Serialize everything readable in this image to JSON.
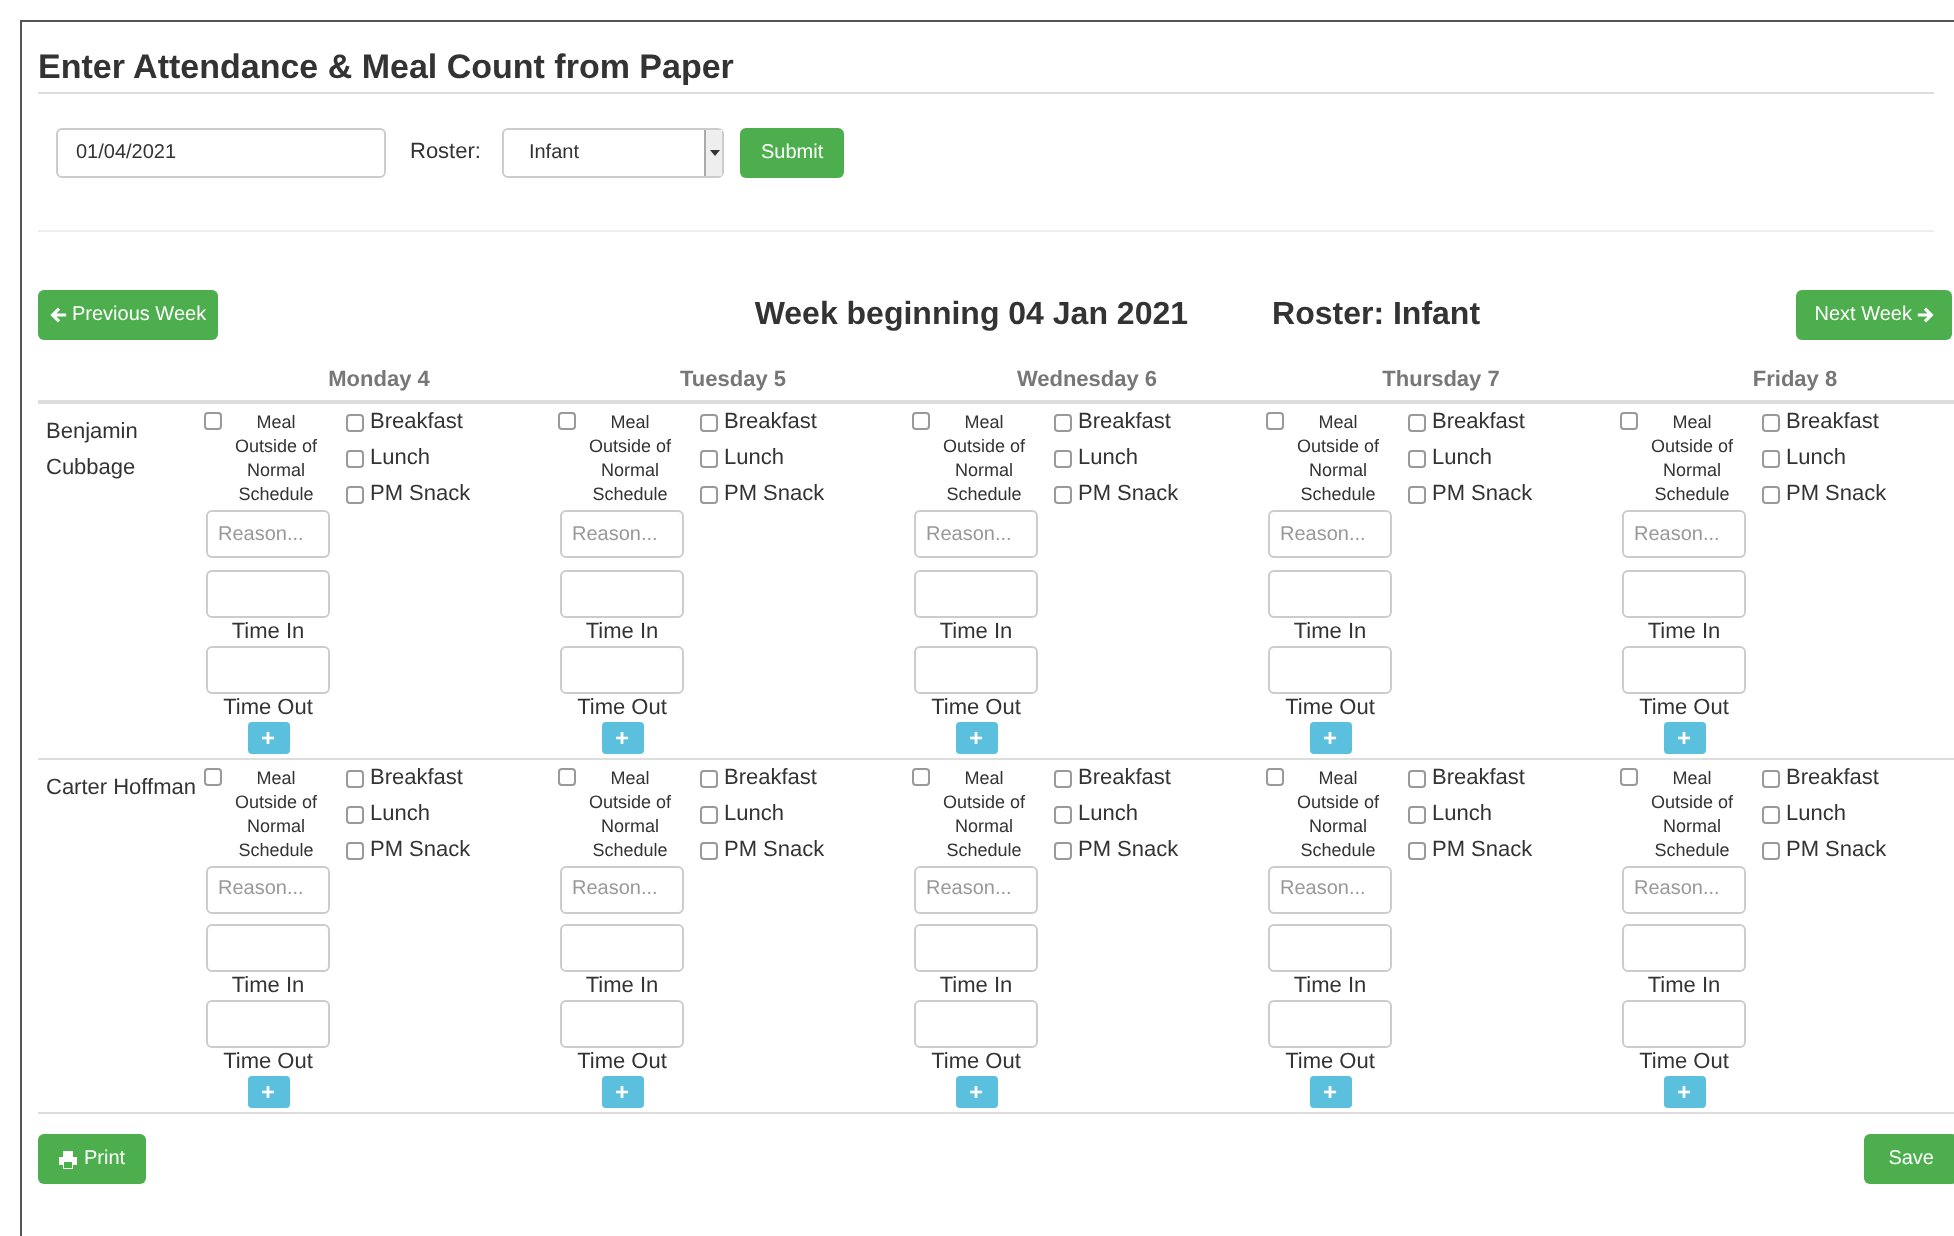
{
  "title": "Enter Attendance & Meal Count from Paper",
  "form": {
    "date": "01/04/2021",
    "roster_label": "Roster:",
    "roster_value": "Infant",
    "submit": "Submit"
  },
  "week_nav": {
    "previous": "Previous Week",
    "heading": "Week beginning 04 Jan 2021",
    "roster_heading": "Roster: Infant",
    "next": "Next Week"
  },
  "days": [
    "Monday 4",
    "Tuesday 5",
    "Wednesday 6",
    "Thursday 7",
    "Friday 8"
  ],
  "children": [
    {
      "name": "Benjamin Cubbage",
      "days": [
        {
          "meal_outside": {
            "label": "Meal Outside of Normal Schedule",
            "checked": false
          },
          "meals": [
            {
              "label": "Breakfast",
              "checked": false
            },
            {
              "label": "Lunch",
              "checked": false
            },
            {
              "label": "PM Snack",
              "checked": false
            }
          ],
          "reason_placeholder": "Reason...",
          "time_in": "Time In",
          "time_out": "Time Out",
          "add": "+"
        },
        {
          "meal_outside": {
            "label": "Meal Outside of Normal Schedule",
            "checked": false
          },
          "meals": [
            {
              "label": "Breakfast",
              "checked": false
            },
            {
              "label": "Lunch",
              "checked": false
            },
            {
              "label": "PM Snack",
              "checked": false
            }
          ],
          "reason_placeholder": "Reason...",
          "time_in": "Time In",
          "time_out": "Time Out",
          "add": "+"
        },
        {
          "meal_outside": {
            "label": "Meal Outside of Normal Schedule",
            "checked": false
          },
          "meals": [
            {
              "label": "Breakfast",
              "checked": false
            },
            {
              "label": "Lunch",
              "checked": false
            },
            {
              "label": "PM Snack",
              "checked": false
            }
          ],
          "reason_placeholder": "Reason...",
          "time_in": "Time In",
          "time_out": "Time Out",
          "add": "+"
        },
        {
          "meal_outside": {
            "label": "Meal Outside of Normal Schedule",
            "checked": false
          },
          "meals": [
            {
              "label": "Breakfast",
              "checked": false
            },
            {
              "label": "Lunch",
              "checked": false
            },
            {
              "label": "PM Snack",
              "checked": false
            }
          ],
          "reason_placeholder": "Reason...",
          "time_in": "Time In",
          "time_out": "Time Out",
          "add": "+"
        },
        {
          "meal_outside": {
            "label": "Meal Outside of Normal Schedule",
            "checked": false
          },
          "meals": [
            {
              "label": "Breakfast",
              "checked": false
            },
            {
              "label": "Lunch",
              "checked": false
            },
            {
              "label": "PM Snack",
              "checked": false
            }
          ],
          "reason_placeholder": "Reason...",
          "time_in": "Time In",
          "time_out": "Time Out",
          "add": "+"
        }
      ]
    },
    {
      "name": "Carter Hoffman",
      "days": [
        {
          "meal_outside": {
            "label": "Meal Outside of Normal Schedule",
            "checked": false
          },
          "meals": [
            {
              "label": "Breakfast",
              "checked": false
            },
            {
              "label": "Lunch",
              "checked": false
            },
            {
              "label": "PM Snack",
              "checked": false
            }
          ],
          "reason_placeholder": "Reason...",
          "time_in": "Time In",
          "time_out": "Time Out",
          "add": "+"
        },
        {
          "meal_outside": {
            "label": "Meal Outside of Normal Schedule",
            "checked": false
          },
          "meals": [
            {
              "label": "Breakfast",
              "checked": false
            },
            {
              "label": "Lunch",
              "checked": false
            },
            {
              "label": "PM Snack",
              "checked": false
            }
          ],
          "reason_placeholder": "Reason...",
          "time_in": "Time In",
          "time_out": "Time Out",
          "add": "+"
        },
        {
          "meal_outside": {
            "label": "Meal Outside of Normal Schedule",
            "checked": false
          },
          "meals": [
            {
              "label": "Breakfast",
              "checked": false
            },
            {
              "label": "Lunch",
              "checked": false
            },
            {
              "label": "PM Snack",
              "checked": false
            }
          ],
          "reason_placeholder": "Reason...",
          "time_in": "Time In",
          "time_out": "Time Out",
          "add": "+"
        },
        {
          "meal_outside": {
            "label": "Meal Outside of Normal Schedule",
            "checked": false
          },
          "meals": [
            {
              "label": "Breakfast",
              "checked": false
            },
            {
              "label": "Lunch",
              "checked": false
            },
            {
              "label": "PM Snack",
              "checked": false
            }
          ],
          "reason_placeholder": "Reason...",
          "time_in": "Time In",
          "time_out": "Time Out",
          "add": "+"
        },
        {
          "meal_outside": {
            "label": "Meal Outside of Normal Schedule",
            "checked": false
          },
          "meals": [
            {
              "label": "Breakfast",
              "checked": false
            },
            {
              "label": "Lunch",
              "checked": false
            },
            {
              "label": "PM Snack",
              "checked": false
            }
          ],
          "reason_placeholder": "Reason...",
          "time_in": "Time In",
          "time_out": "Time Out",
          "add": "+"
        }
      ]
    }
  ],
  "footer": {
    "print": "Print",
    "save": "Save"
  }
}
